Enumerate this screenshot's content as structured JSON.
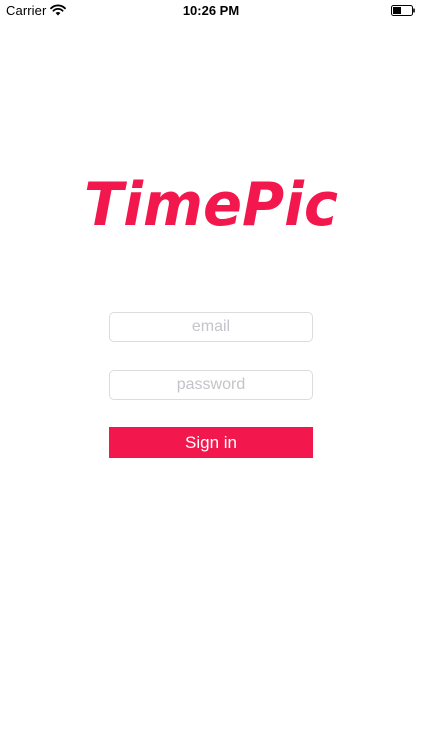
{
  "status_bar": {
    "carrier": "Carrier",
    "time": "10:26 PM",
    "wifi_icon": "wifi-icon",
    "battery_icon": "battery-icon"
  },
  "logo": {
    "text": "TimePic"
  },
  "login_form": {
    "email_placeholder": "email",
    "password_placeholder": "password",
    "sign_in_label": "Sign in"
  },
  "colors": {
    "accent": "#f2184d",
    "field_border": "#dcdcdc",
    "placeholder": "#c4c4c9"
  }
}
